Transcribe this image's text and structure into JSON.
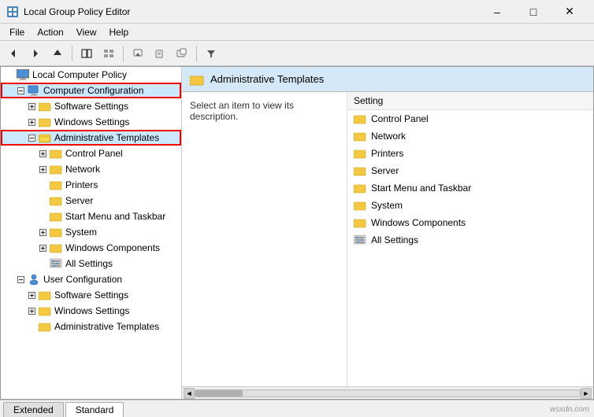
{
  "titleBar": {
    "title": "Local Group Policy Editor",
    "minLabel": "–",
    "maxLabel": "□",
    "closeLabel": "✕"
  },
  "menuBar": {
    "items": [
      "File",
      "Action",
      "View",
      "Help"
    ]
  },
  "toolbar": {
    "buttons": [
      "◄",
      "►",
      "▲",
      "⬛",
      "📋",
      "🔧",
      "📁",
      "▶",
      "🔎"
    ]
  },
  "tree": {
    "nodes": [
      {
        "id": "local-computer-policy",
        "label": "Local Computer Policy",
        "indent": 0,
        "expanded": true,
        "hasExpand": false,
        "icon": "monitor"
      },
      {
        "id": "computer-configuration",
        "label": "Computer Configuration",
        "indent": 1,
        "expanded": true,
        "hasExpand": true,
        "icon": "computer",
        "highlighted": true
      },
      {
        "id": "software-settings",
        "label": "Software Settings",
        "indent": 2,
        "expanded": false,
        "hasExpand": true,
        "icon": "folder"
      },
      {
        "id": "windows-settings-cc",
        "label": "Windows Settings",
        "indent": 2,
        "expanded": false,
        "hasExpand": true,
        "icon": "folder"
      },
      {
        "id": "administrative-templates",
        "label": "Administrative Templates",
        "indent": 2,
        "expanded": true,
        "hasExpand": true,
        "icon": "folder-open",
        "selected": true,
        "highlighted": true
      },
      {
        "id": "control-panel",
        "label": "Control Panel",
        "indent": 3,
        "expanded": false,
        "hasExpand": true,
        "icon": "folder"
      },
      {
        "id": "network",
        "label": "Network",
        "indent": 3,
        "expanded": false,
        "hasExpand": true,
        "icon": "folder"
      },
      {
        "id": "printers",
        "label": "Printers",
        "indent": 3,
        "expanded": false,
        "hasExpand": false,
        "icon": "folder"
      },
      {
        "id": "server",
        "label": "Server",
        "indent": 3,
        "expanded": false,
        "hasExpand": false,
        "icon": "folder"
      },
      {
        "id": "start-menu-taskbar",
        "label": "Start Menu and Taskbar",
        "indent": 3,
        "expanded": false,
        "hasExpand": false,
        "icon": "folder"
      },
      {
        "id": "system",
        "label": "System",
        "indent": 3,
        "expanded": false,
        "hasExpand": true,
        "icon": "folder"
      },
      {
        "id": "windows-components",
        "label": "Windows Components",
        "indent": 3,
        "expanded": false,
        "hasExpand": true,
        "icon": "folder"
      },
      {
        "id": "all-settings",
        "label": "All Settings",
        "indent": 3,
        "expanded": false,
        "hasExpand": false,
        "icon": "settings"
      },
      {
        "id": "user-configuration",
        "label": "User Configuration",
        "indent": 1,
        "expanded": true,
        "hasExpand": true,
        "icon": "user"
      },
      {
        "id": "software-settings-uc",
        "label": "Software Settings",
        "indent": 2,
        "expanded": false,
        "hasExpand": true,
        "icon": "folder"
      },
      {
        "id": "windows-settings-uc",
        "label": "Windows Settings",
        "indent": 2,
        "expanded": false,
        "hasExpand": true,
        "icon": "folder"
      },
      {
        "id": "administrative-templates-uc",
        "label": "Administrative Templates",
        "indent": 2,
        "expanded": false,
        "hasExpand": false,
        "icon": "folder"
      }
    ]
  },
  "rightPanel": {
    "header": "Administrative Templates",
    "description": "Select an item to view its description.",
    "columnHeader": "Setting",
    "items": [
      {
        "id": "control-panel",
        "label": "Control Panel",
        "icon": "folder"
      },
      {
        "id": "network",
        "label": "Network",
        "icon": "folder"
      },
      {
        "id": "printers",
        "label": "Printers",
        "icon": "folder"
      },
      {
        "id": "server",
        "label": "Server",
        "icon": "folder"
      },
      {
        "id": "start-menu-taskbar",
        "label": "Start Menu and Taskbar",
        "icon": "folder"
      },
      {
        "id": "system",
        "label": "System",
        "icon": "folder"
      },
      {
        "id": "windows-components",
        "label": "Windows Components",
        "icon": "folder"
      },
      {
        "id": "all-settings",
        "label": "All Settings",
        "icon": "settings"
      }
    ]
  },
  "tabs": [
    {
      "id": "extended",
      "label": "Extended"
    },
    {
      "id": "standard",
      "label": "Standard"
    }
  ],
  "activeTab": "standard",
  "watermark": "wsxdn.com"
}
